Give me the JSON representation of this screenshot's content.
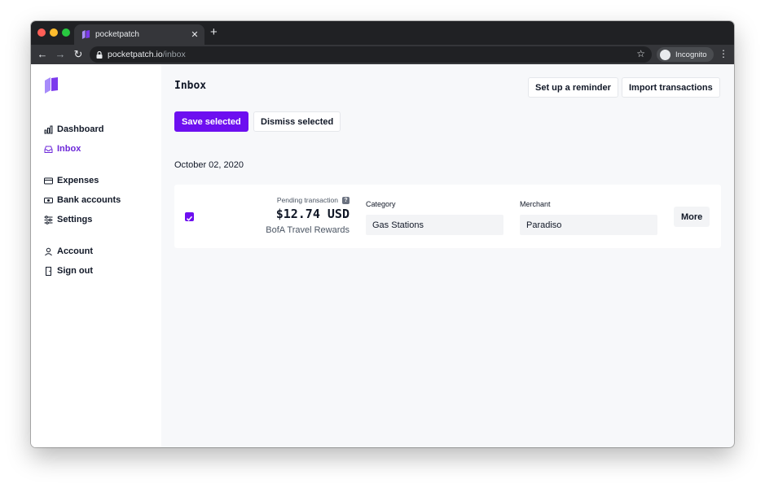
{
  "browser": {
    "tab_title": "pocketpatch",
    "url_host": "pocketpatch.io",
    "url_path": "/inbox",
    "profile_label": "Incognito"
  },
  "sidebar": {
    "items": [
      {
        "label": "Dashboard",
        "icon": "chart-bar-icon",
        "active": false
      },
      {
        "label": "Inbox",
        "icon": "inbox-icon",
        "active": true
      },
      {
        "label": "Expenses",
        "icon": "credit-card-icon",
        "active": false
      },
      {
        "label": "Bank accounts",
        "icon": "cash-icon",
        "active": false
      },
      {
        "label": "Settings",
        "icon": "sliders-icon",
        "active": false
      },
      {
        "label": "Account",
        "icon": "user-icon",
        "active": false
      },
      {
        "label": "Sign out",
        "icon": "door-icon",
        "active": false
      }
    ]
  },
  "main": {
    "title": "Inbox",
    "header_buttons": {
      "reminder": "Set up a reminder",
      "import": "Import transactions"
    },
    "actions": {
      "save": "Save selected",
      "dismiss": "Dismiss selected"
    },
    "date_heading": "October 02, 2020",
    "transactions": [
      {
        "selected": true,
        "status": "Pending transaction",
        "help_symbol": "?",
        "amount": "$12.74 USD",
        "account": "BofA Travel Rewards",
        "category_label": "Category",
        "category_value": "Gas Stations",
        "merchant_label": "Merchant",
        "merchant_value": "Paradiso",
        "more_label": "More"
      }
    ]
  },
  "colors": {
    "accent": "#6d0ff0",
    "active_nav": "#6d28d9"
  }
}
